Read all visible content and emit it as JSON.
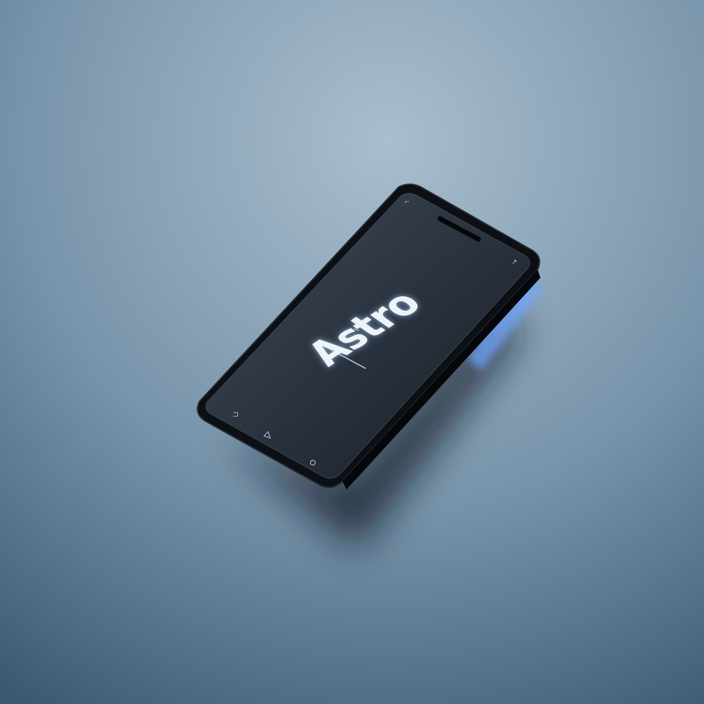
{
  "device": {
    "brand_text": "Astro"
  },
  "colors": {
    "background_light": "#a3b8c8",
    "background_dark": "#3f5f78",
    "phone_body": "#0d1014",
    "screen_top": "#3a4350",
    "screen_bottom": "#1a222c",
    "glow": "#6fa8ff"
  }
}
